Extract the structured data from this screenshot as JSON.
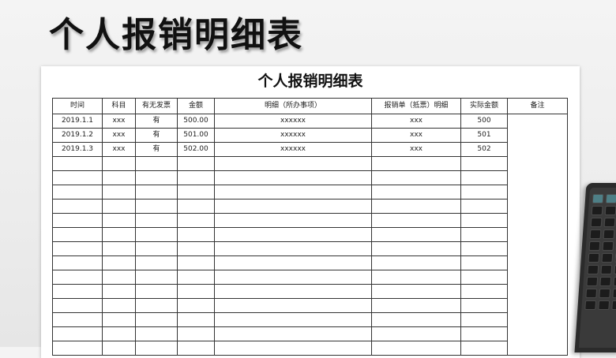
{
  "banner": {
    "title": "个人报销明细表"
  },
  "sheet": {
    "title": "个人报销明细表",
    "headers": [
      "时间",
      "科目",
      "有无发票",
      "金额",
      "明细（所办事项）",
      "报销单（抵票）明细",
      "实际金额",
      "备注"
    ],
    "rows": [
      [
        "2019.1.1",
        "xxx",
        "有",
        "500.00",
        "xxxxxx",
        "xxx",
        "500"
      ],
      [
        "2019.1.2",
        "xxx",
        "有",
        "501.00",
        "xxxxxx",
        "xxx",
        "501"
      ],
      [
        "2019.1.3",
        "xxx",
        "有",
        "502.00",
        "xxxxxx",
        "xxx",
        "502"
      ]
    ],
    "notes": ""
  },
  "icons": {
    "laptop": "laptop-keyboard-icon"
  }
}
